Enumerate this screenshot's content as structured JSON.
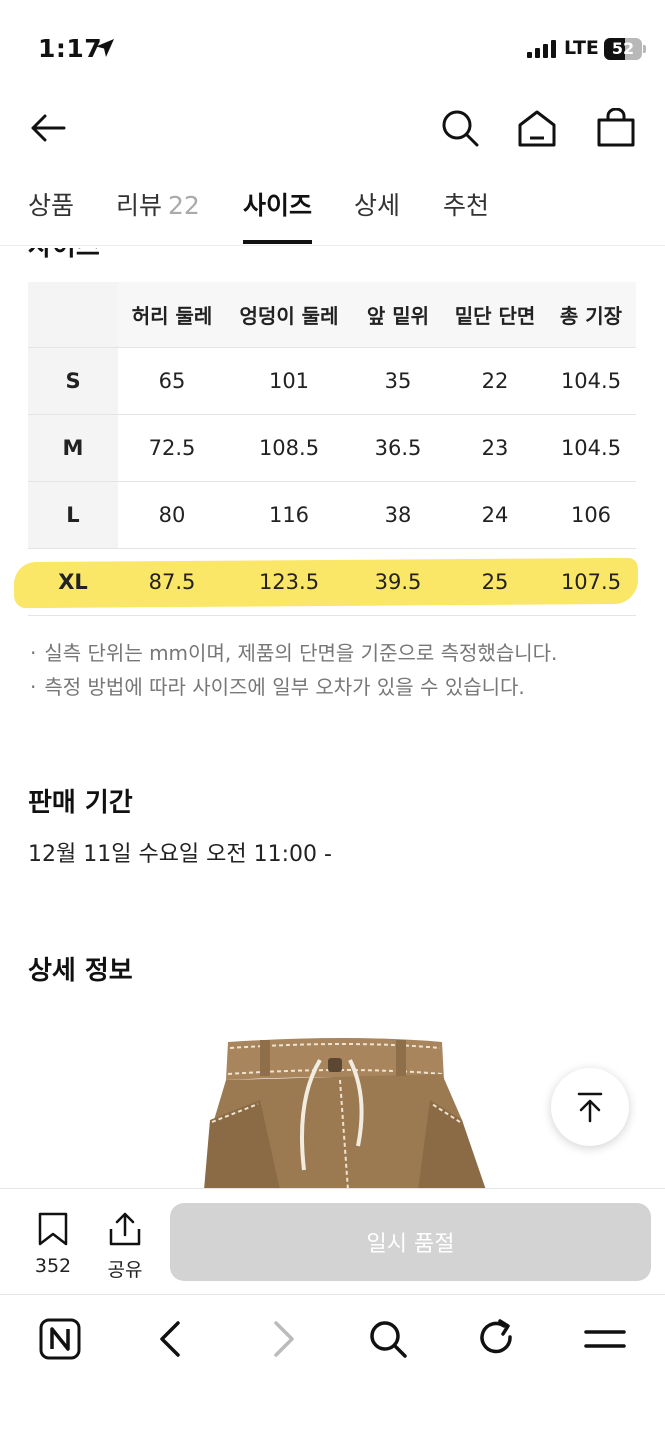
{
  "status_bar": {
    "time": "1:17",
    "network": "LTE",
    "battery": "52"
  },
  "header": {
    "back_icon": "arrow-left-icon",
    "search_icon": "search-icon",
    "home_icon": "home-icon",
    "cart_icon": "shopping-bag-icon"
  },
  "tabs": [
    {
      "label": "상품",
      "count": ""
    },
    {
      "label": "리뷰",
      "count": "22"
    },
    {
      "label": "사이즈",
      "count": "",
      "active": true
    },
    {
      "label": "상세",
      "count": ""
    },
    {
      "label": "추천",
      "count": ""
    }
  ],
  "size_section": {
    "title": "사이즈",
    "columns": [
      "허리 둘레",
      "엉덩이 둘레",
      "앞 밑위",
      "밑단 단면",
      "총 기장"
    ],
    "rows": [
      {
        "size": "S",
        "values": [
          "65",
          "101",
          "35",
          "22",
          "104.5"
        ]
      },
      {
        "size": "M",
        "values": [
          "72.5",
          "108.5",
          "36.5",
          "23",
          "104.5"
        ]
      },
      {
        "size": "L",
        "values": [
          "80",
          "116",
          "38",
          "24",
          "106"
        ]
      },
      {
        "size": "XL",
        "values": [
          "87.5",
          "123.5",
          "39.5",
          "25",
          "107.5"
        ]
      }
    ],
    "highlighted_size": "XL",
    "highlight_color": "#f9e24c",
    "notes": [
      "실측 단위는 mm이며, 제품의 단면을 기준으로 측정했습니다.",
      "측정 방법에 따라 사이즈에 일부 오차가 있을 수 있습니다."
    ]
  },
  "sale_period": {
    "title": "판매 기간",
    "value": "12월 11일 수요일 오전 11:00 -"
  },
  "detail_info": {
    "title": "상세 정보"
  },
  "action_bar": {
    "bookmark_count": "352",
    "share_label": "공유",
    "soldout_label": "일시 품절"
  },
  "browser_bar": {
    "icons": [
      "naver-icon",
      "back-icon",
      "forward-icon",
      "search-icon",
      "refresh-icon",
      "menu-icon"
    ]
  }
}
